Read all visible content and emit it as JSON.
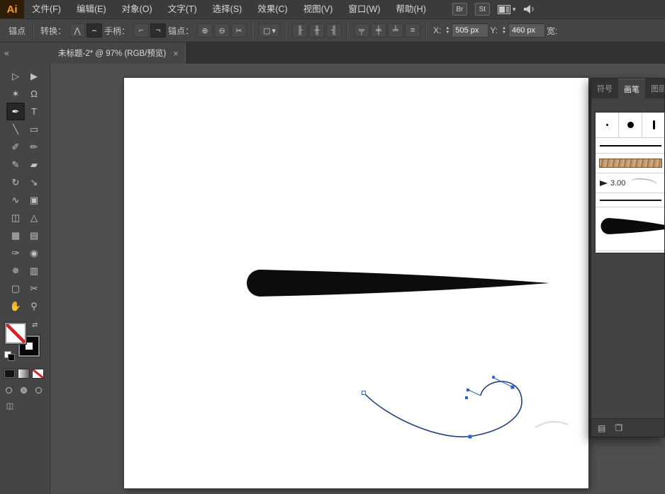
{
  "menubar": {
    "logo": "Ai",
    "items": [
      "文件(F)",
      "编辑(E)",
      "对象(O)",
      "文字(T)",
      "选择(S)",
      "效果(C)",
      "视图(V)",
      "窗口(W)",
      "帮助(H)"
    ],
    "bridge_badge": "Br",
    "stock_badge": "St",
    "caret_icon": "▾",
    "icons": {
      "arrange_documents": "two-pane-grid",
      "megaphone": "speaker-shape"
    }
  },
  "controlbar": {
    "anchor_label": "锚点",
    "convert_label": "转换：",
    "convert_icons": [
      "⋀",
      "⌢"
    ],
    "handle_label": "手柄：",
    "handle_icons": [
      "⌐",
      "¬"
    ],
    "anchor_edit_label": "锚点：",
    "anchor_edit_icons": [
      "⊕",
      "⊖",
      "✂"
    ],
    "isolate_icon": "▢",
    "caret_icon": "▾",
    "align_icons": [
      "╟",
      "╫",
      "╢"
    ],
    "valign_icons": [
      "╤",
      "╪",
      "╧",
      "≡"
    ],
    "stepper_up": "▲",
    "stepper_down": "▼",
    "x_label": "X:",
    "x_value": "505 px",
    "y_label": "Y:",
    "y_value": "460 px",
    "width_label": "宽:"
  },
  "tabbar": {
    "collapse_icon": "«",
    "tab_title": "未标题-2* @ 97% (RGB/预览)",
    "close_icon": "×"
  },
  "toolbar": {
    "swap_icon": "⇄",
    "screen_mode_icon": "◫",
    "tools": [
      {
        "name": "direct-selection-tool",
        "glyph": "▷"
      },
      {
        "name": "selection-tool",
        "glyph": "▶"
      },
      {
        "name": "magic-wand-tool",
        "glyph": "✶"
      },
      {
        "name": "lasso-tool",
        "glyph": "Ω"
      },
      {
        "name": "pen-tool",
        "glyph": "✒",
        "active": true
      },
      {
        "name": "type-tool",
        "glyph": "T"
      },
      {
        "name": "line-segment-tool",
        "glyph": "╲"
      },
      {
        "name": "rectangle-tool",
        "glyph": "▭"
      },
      {
        "name": "paintbrush-tool",
        "glyph": "✐"
      },
      {
        "name": "pencil-tool",
        "glyph": "✏"
      },
      {
        "name": "blob-brush-tool",
        "glyph": "✎"
      },
      {
        "name": "eraser-tool",
        "glyph": "▰"
      },
      {
        "name": "rotate-tool",
        "glyph": "↻"
      },
      {
        "name": "scale-tool",
        "glyph": "↘"
      },
      {
        "name": "width-tool",
        "glyph": "∿"
      },
      {
        "name": "free-transform-tool",
        "glyph": "▣"
      },
      {
        "name": "shape-builder-tool",
        "glyph": "◫"
      },
      {
        "name": "perspective-grid-tool",
        "glyph": "△"
      },
      {
        "name": "mesh-tool",
        "glyph": "▦"
      },
      {
        "name": "gradient-tool",
        "glyph": "▤"
      },
      {
        "name": "eyedropper-tool",
        "glyph": "✑"
      },
      {
        "name": "blend-tool",
        "glyph": "◉"
      },
      {
        "name": "symbol-sprayer-tool",
        "glyph": "✵"
      },
      {
        "name": "column-graph-tool",
        "glyph": "▥"
      },
      {
        "name": "artboard-tool",
        "glyph": "▢"
      },
      {
        "name": "slice-tool",
        "glyph": "✂"
      },
      {
        "name": "hand-tool",
        "glyph": "✋"
      },
      {
        "name": "zoom-tool",
        "glyph": "⚲"
      }
    ]
  },
  "panel": {
    "tabs": [
      {
        "label": "符号",
        "active": false
      },
      {
        "label": "画笔",
        "active": true
      },
      {
        "label": "图层",
        "active": false
      }
    ],
    "brush_size_label": "3.00",
    "footer_icons": [
      "▤",
      "❐"
    ]
  },
  "colors": {
    "selection_blue": "#2f63c9",
    "path_navy": "#23407e",
    "artwork_black": "#0c0c0c",
    "pattern_tan": "#c09568",
    "canvas_gray": "#4e4f50"
  }
}
